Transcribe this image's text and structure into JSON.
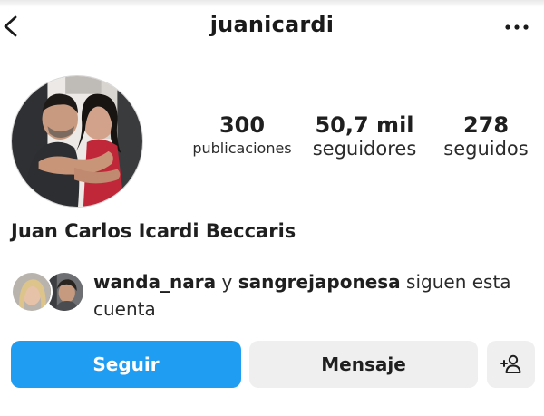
{
  "header": {
    "username": "juanicardi",
    "back_icon": "chevron-left-icon",
    "more_icon": "more-horizontal-icon"
  },
  "profile": {
    "full_name": "Juan Carlos Icardi Beccaris",
    "stats": {
      "posts_count": "300",
      "posts_label": "publicaciones",
      "followers_count": "50,7 mil",
      "followers_label": "seguidores",
      "following_count": "278",
      "following_label": "seguidos"
    }
  },
  "mutuals": {
    "user1": "wanda_nara",
    "connector": "y",
    "user2": "sangrejaponesa",
    "suffix": "siguen esta cuenta"
  },
  "actions": {
    "follow_label": "Seguir",
    "message_label": "Mensaje",
    "suggest_icon": "add-person-icon"
  },
  "colors": {
    "follow_blue": "#1e9df2",
    "secondary_gray": "#efefef"
  }
}
